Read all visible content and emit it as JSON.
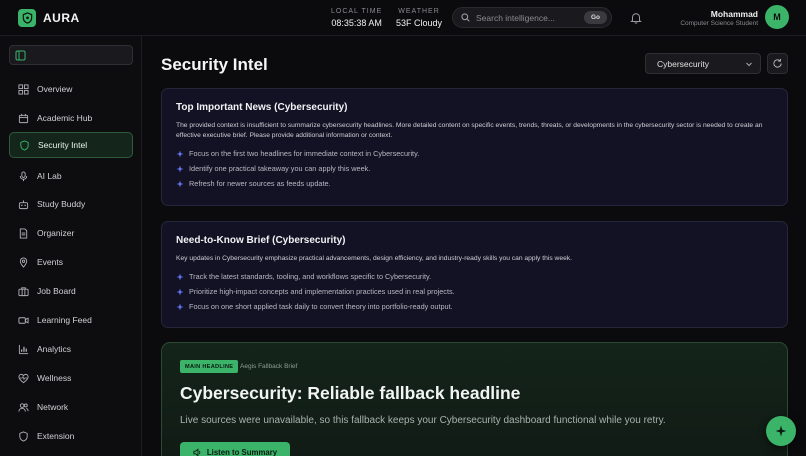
{
  "brand": {
    "name": "AURA",
    "logo_icon": "shield-icon",
    "accent": "#3bb46a"
  },
  "header": {
    "local_time_label": "LOCAL TIME",
    "local_time": "08:35:38 AM",
    "weather_label": "WEATHER",
    "weather": "53F Cloudy",
    "search_placeholder": "Search intelligence...",
    "search_button": "Go",
    "user": {
      "name": "Mohammad",
      "role": "Computer Science Student",
      "initial": "M"
    }
  },
  "sidebar": {
    "items": [
      {
        "label": "Overview",
        "icon": "grid-icon"
      },
      {
        "label": "Academic Hub",
        "icon": "calendar-icon"
      },
      {
        "label": "Security Intel",
        "icon": "shield-icon",
        "active": true
      },
      {
        "label": "AI Lab",
        "icon": "mic-icon"
      },
      {
        "label": "Study Buddy",
        "icon": "bot-icon"
      },
      {
        "label": "Organizer",
        "icon": "document-icon"
      },
      {
        "label": "Events",
        "icon": "location-pin-icon"
      },
      {
        "label": "Job Board",
        "icon": "briefcase-icon"
      },
      {
        "label": "Learning Feed",
        "icon": "video-icon"
      },
      {
        "label": "Analytics",
        "icon": "bar-chart-icon"
      },
      {
        "label": "Wellness",
        "icon": "heart-pulse-icon"
      },
      {
        "label": "Network",
        "icon": "users-icon"
      },
      {
        "label": "Extension",
        "icon": "shield-icon"
      }
    ]
  },
  "main": {
    "title": "Security Intel",
    "topic_select": "Cybersecurity",
    "cards": [
      {
        "title": "Top Important News (Cybersecurity)",
        "body": "The provided context is insufficient to summarize cybersecurity headlines. More detailed content on specific events, trends, threats, or developments in the cybersecurity sector is needed to create an effective executive brief. Please provide additional information or context.",
        "bullets": [
          "Focus on the first two headlines for immediate context in Cybersecurity.",
          "Identify one practical takeaway you can apply this week.",
          "Refresh for newer sources as feeds update."
        ]
      },
      {
        "title": "Need-to-Know Brief (Cybersecurity)",
        "body": "Key updates in Cybersecurity emphasize practical advancements, design efficiency, and industry-ready skills you can apply this week.",
        "bullets": [
          "Track the latest standards, tooling, and workflows specific to Cybersecurity.",
          "Prioritize high-impact concepts and implementation practices used in real projects.",
          "Focus on one short applied task daily to convert theory into portfolio-ready output."
        ]
      }
    ],
    "headline_card": {
      "tag": "MAIN HEADLINE",
      "source": "Aegis Fallback Brief",
      "headline": "Cybersecurity: Reliable fallback headline",
      "description": "Live sources were unavailable, so this fallback keeps your Cybersecurity dashboard functional while you retry.",
      "listen_button": "Listen to Summary"
    }
  }
}
